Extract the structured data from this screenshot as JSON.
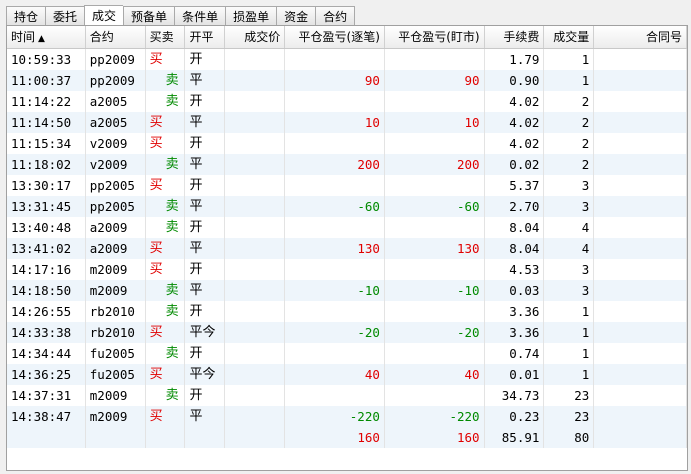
{
  "tabs": [
    "持仓",
    "委托",
    "成交",
    "预备单",
    "条件单",
    "损盈单",
    "资金",
    "合约"
  ],
  "active_tab": 2,
  "columns": [
    "时间",
    "合约",
    "买卖",
    "开平",
    "成交价",
    "平仓盈亏(逐笔)",
    "平仓盈亏(盯市)",
    "手续费",
    "成交量",
    "合同号"
  ],
  "sort_indicator": "▲",
  "rows": [
    {
      "time": "10:59:33",
      "contract": "pp2009",
      "buy": "买",
      "sell": "",
      "openclose": "开",
      "price": "",
      "pnl_trade": "",
      "pnl_mark": "",
      "fee": "1.79",
      "volume": "1",
      "order_id": ""
    },
    {
      "time": "11:00:37",
      "contract": "pp2009",
      "buy": "",
      "sell": "卖",
      "openclose": "平",
      "price": "",
      "pnl_trade": "90",
      "pnl_mark": "90",
      "fee": "0.90",
      "volume": "1",
      "order_id": ""
    },
    {
      "time": "11:14:22",
      "contract": "a2005",
      "buy": "",
      "sell": "卖",
      "openclose": "开",
      "price": "",
      "pnl_trade": "",
      "pnl_mark": "",
      "fee": "4.02",
      "volume": "2",
      "order_id": ""
    },
    {
      "time": "11:14:50",
      "contract": "a2005",
      "buy": "买",
      "sell": "",
      "openclose": "平",
      "price": "",
      "pnl_trade": "10",
      "pnl_mark": "10",
      "fee": "4.02",
      "volume": "2",
      "order_id": ""
    },
    {
      "time": "11:15:34",
      "contract": "v2009",
      "buy": "买",
      "sell": "",
      "openclose": "开",
      "price": "",
      "pnl_trade": "",
      "pnl_mark": "",
      "fee": "4.02",
      "volume": "2",
      "order_id": ""
    },
    {
      "time": "11:18:02",
      "contract": "v2009",
      "buy": "",
      "sell": "卖",
      "openclose": "平",
      "price": "",
      "pnl_trade": "200",
      "pnl_mark": "200",
      "fee": "0.02",
      "volume": "2",
      "order_id": ""
    },
    {
      "time": "13:30:17",
      "contract": "pp2005",
      "buy": "买",
      "sell": "",
      "openclose": "开",
      "price": "",
      "pnl_trade": "",
      "pnl_mark": "",
      "fee": "5.37",
      "volume": "3",
      "order_id": ""
    },
    {
      "time": "13:31:45",
      "contract": "pp2005",
      "buy": "",
      "sell": "卖",
      "openclose": "平",
      "price": "",
      "pnl_trade": "-60",
      "pnl_mark": "-60",
      "fee": "2.70",
      "volume": "3",
      "order_id": ""
    },
    {
      "time": "13:40:48",
      "contract": "a2009",
      "buy": "",
      "sell": "卖",
      "openclose": "开",
      "price": "",
      "pnl_trade": "",
      "pnl_mark": "",
      "fee": "8.04",
      "volume": "4",
      "order_id": ""
    },
    {
      "time": "13:41:02",
      "contract": "a2009",
      "buy": "买",
      "sell": "",
      "openclose": "平",
      "price": "",
      "pnl_trade": "130",
      "pnl_mark": "130",
      "fee": "8.04",
      "volume": "4",
      "order_id": ""
    },
    {
      "time": "14:17:16",
      "contract": "m2009",
      "buy": "买",
      "sell": "",
      "openclose": "开",
      "price": "",
      "pnl_trade": "",
      "pnl_mark": "",
      "fee": "4.53",
      "volume": "3",
      "order_id": ""
    },
    {
      "time": "14:18:50",
      "contract": "m2009",
      "buy": "",
      "sell": "卖",
      "openclose": "平",
      "price": "",
      "pnl_trade": "-10",
      "pnl_mark": "-10",
      "fee": "0.03",
      "volume": "3",
      "order_id": ""
    },
    {
      "time": "14:26:55",
      "contract": "rb2010",
      "buy": "",
      "sell": "卖",
      "openclose": "开",
      "price": "",
      "pnl_trade": "",
      "pnl_mark": "",
      "fee": "3.36",
      "volume": "1",
      "order_id": ""
    },
    {
      "time": "14:33:38",
      "contract": "rb2010",
      "buy": "买",
      "sell": "",
      "openclose": "平今",
      "price": "",
      "pnl_trade": "-20",
      "pnl_mark": "-20",
      "fee": "3.36",
      "volume": "1",
      "order_id": ""
    },
    {
      "time": "14:34:44",
      "contract": "fu2005",
      "buy": "",
      "sell": "卖",
      "openclose": "开",
      "price": "",
      "pnl_trade": "",
      "pnl_mark": "",
      "fee": "0.74",
      "volume": "1",
      "order_id": ""
    },
    {
      "time": "14:36:25",
      "contract": "fu2005",
      "buy": "买",
      "sell": "",
      "openclose": "平今",
      "price": "",
      "pnl_trade": "40",
      "pnl_mark": "40",
      "fee": "0.01",
      "volume": "1",
      "order_id": ""
    },
    {
      "time": "14:37:31",
      "contract": "m2009",
      "buy": "",
      "sell": "卖",
      "openclose": "开",
      "price": "",
      "pnl_trade": "",
      "pnl_mark": "",
      "fee": "34.73",
      "volume": "23",
      "order_id": ""
    },
    {
      "time": "14:38:47",
      "contract": "m2009",
      "buy": "买",
      "sell": "",
      "openclose": "平",
      "price": "",
      "pnl_trade": "-220",
      "pnl_mark": "-220",
      "fee": "0.23",
      "volume": "23",
      "order_id": ""
    }
  ],
  "totals": {
    "pnl_trade": "160",
    "pnl_mark": "160",
    "fee": "85.91",
    "volume": "80"
  },
  "colors": {
    "buy": "#e00000",
    "sell": "#008a00",
    "profit": "#e00000",
    "loss": "#008a00",
    "row_alt": "#eef5fb"
  }
}
